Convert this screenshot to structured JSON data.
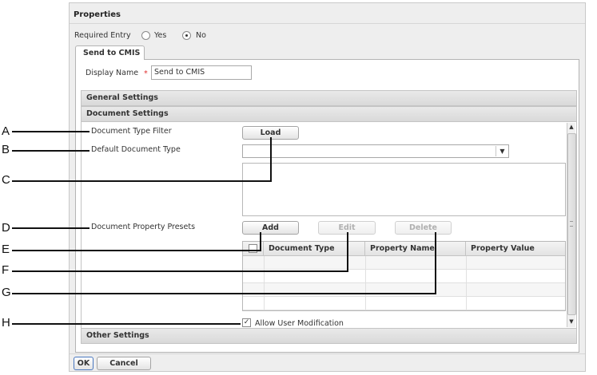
{
  "panel": {
    "title": "Properties"
  },
  "required_entry": {
    "label": "Required Entry",
    "yes_label": "Yes",
    "no_label": "No",
    "selected": "No"
  },
  "tab": {
    "label": "Send to CMIS"
  },
  "display_name": {
    "label": "Display Name",
    "required_marker": "*",
    "value": "Send to CMIS"
  },
  "sections": {
    "general": "General Settings",
    "document": "Document Settings",
    "other": "Other Settings"
  },
  "document_settings": {
    "type_filter_label": "Document Type Filter",
    "load_button": "Load",
    "default_type_label": "Default Document Type",
    "default_type_value": "",
    "presets_label": "Document Property Presets",
    "add_button": "Add",
    "edit_button": "Edit",
    "delete_button": "Delete",
    "table": {
      "columns": [
        "Document Type",
        "Property Name",
        "Property Value"
      ],
      "rows": [
        [
          "",
          "",
          ""
        ],
        [
          "",
          "",
          ""
        ],
        [
          "",
          "",
          ""
        ],
        [
          "",
          "",
          ""
        ]
      ]
    },
    "allow_user_modification": {
      "label": "Allow User Modification",
      "checked": true
    }
  },
  "footer": {
    "ok": "OK",
    "cancel": "Cancel"
  },
  "callouts": [
    "A",
    "B",
    "C",
    "D",
    "E",
    "F",
    "G",
    "H"
  ],
  "icons": {
    "dropdown": "triangle-down-icon",
    "scroll_up": "triangle-up-icon",
    "scroll_down": "triangle-down-icon"
  }
}
